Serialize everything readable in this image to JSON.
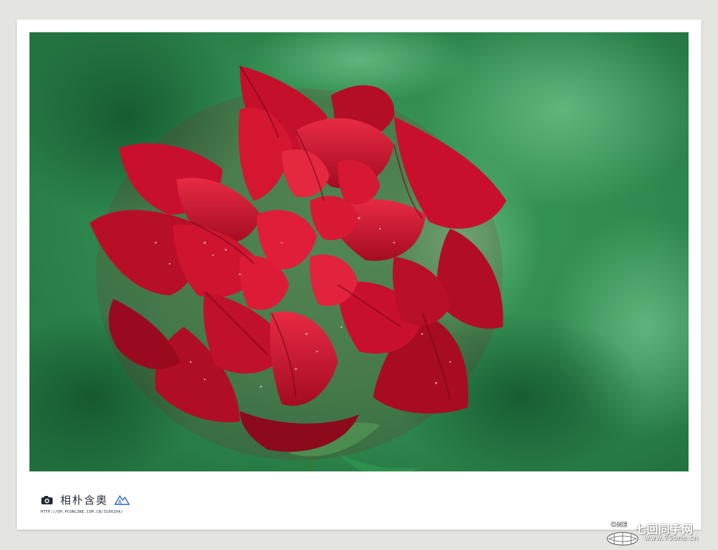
{
  "photo": {
    "subject": "rose-photo",
    "colors": {
      "background_green": "#2f8a4f",
      "petal_red": "#c8102e",
      "petal_dark": "#7a0a14",
      "leaf_green": "#3fa35a"
    }
  },
  "signature": {
    "camera_icon": "camera-icon",
    "name": "相朴含奧",
    "mountain_icon": "mountain-icon",
    "url": "HTTP://DP.PCONLINE.COM.CN/3160204/"
  },
  "watermark": {
    "logo_icon": "globe-logo-icon",
    "logo_word": "ONE",
    "text": "七回同手网",
    "url": "www.75one.cn"
  }
}
